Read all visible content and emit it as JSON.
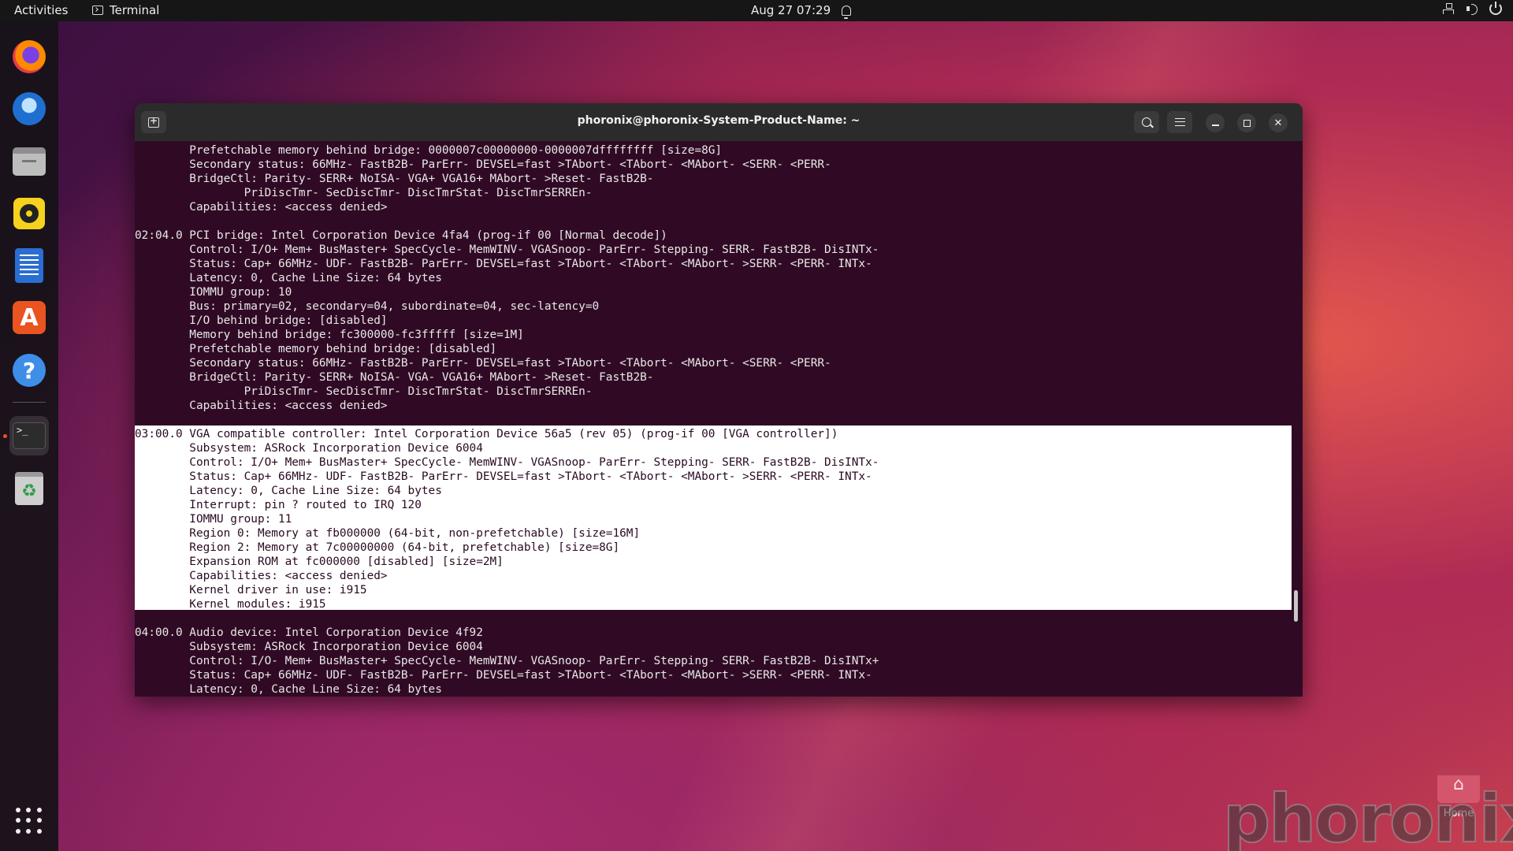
{
  "topbar": {
    "activities": "Activities",
    "app_name": "Terminal",
    "datetime": "Aug 27  07:29",
    "tray_icons": [
      "network-icon",
      "volume-icon",
      "power-icon"
    ]
  },
  "dock": {
    "items": [
      {
        "name": "firefox",
        "icon": "firefox-icon"
      },
      {
        "name": "thunderbird",
        "icon": "thunderbird-icon"
      },
      {
        "name": "files",
        "icon": "files-icon"
      },
      {
        "name": "rhythmbox",
        "icon": "rhythmbox-icon"
      },
      {
        "name": "libreoffice-writer",
        "icon": "writer-icon"
      },
      {
        "name": "app-center",
        "icon": "app-store-icon",
        "glyph": "A"
      },
      {
        "name": "help",
        "icon": "help-icon",
        "glyph": "?"
      },
      {
        "name": "terminal",
        "icon": "terminal-icon",
        "glyph": ">_",
        "active": true
      },
      {
        "name": "trash",
        "icon": "trash-icon",
        "glyph": "♻"
      }
    ],
    "show_apps_icon": "app-grid-icon"
  },
  "terminal": {
    "title": "phoronix@phoronix-System-Product-Name: ~",
    "lines": [
      "        Prefetchable memory behind bridge: 0000007c00000000-0000007dffffffff [size=8G]",
      "        Secondary status: 66MHz- FastB2B- ParErr- DEVSEL=fast >TAbort- <TAbort- <MAbort- <SERR- <PERR-",
      "        BridgeCtl: Parity- SERR+ NoISA- VGA+ VGA16+ MAbort- >Reset- FastB2B-",
      "                PriDiscTmr- SecDiscTmr- DiscTmrStat- DiscTmrSERREn-",
      "        Capabilities: <access denied>",
      "",
      "02:04.0 PCI bridge: Intel Corporation Device 4fa4 (prog-if 00 [Normal decode])",
      "        Control: I/O+ Mem+ BusMaster+ SpecCycle- MemWINV- VGASnoop- ParErr- Stepping- SERR- FastB2B- DisINTx-",
      "        Status: Cap+ 66MHz- UDF- FastB2B- ParErr- DEVSEL=fast >TAbort- <TAbort- <MAbort- >SERR- <PERR- INTx-",
      "        Latency: 0, Cache Line Size: 64 bytes",
      "        IOMMU group: 10",
      "        Bus: primary=02, secondary=04, subordinate=04, sec-latency=0",
      "        I/O behind bridge: [disabled]",
      "        Memory behind bridge: fc300000-fc3fffff [size=1M]",
      "        Prefetchable memory behind bridge: [disabled]",
      "        Secondary status: 66MHz- FastB2B- ParErr- DEVSEL=fast >TAbort- <TAbort- <MAbort- <SERR- <PERR-",
      "        BridgeCtl: Parity- SERR+ NoISA- VGA- VGA16+ MAbort- >Reset- FastB2B-",
      "                PriDiscTmr- SecDiscTmr- DiscTmrStat- DiscTmrSERREn-",
      "        Capabilities: <access denied>",
      "",
      "03:00.0 VGA compatible controller: Intel Corporation Device 56a5 (rev 05) (prog-if 00 [VGA controller])",
      "        Subsystem: ASRock Incorporation Device 6004",
      "        Control: I/O+ Mem+ BusMaster+ SpecCycle- MemWINV- VGASnoop- ParErr- Stepping- SERR- FastB2B- DisINTx-",
      "        Status: Cap+ 66MHz- UDF- FastB2B- ParErr- DEVSEL=fast >TAbort- <TAbort- <MAbort- >SERR- <PERR- INTx-",
      "        Latency: 0, Cache Line Size: 64 bytes",
      "        Interrupt: pin ? routed to IRQ 120",
      "        IOMMU group: 11",
      "        Region 0: Memory at fb000000 (64-bit, non-prefetchable) [size=16M]",
      "        Region 2: Memory at 7c00000000 (64-bit, prefetchable) [size=8G]",
      "        Expansion ROM at fc000000 [disabled] [size=2M]",
      "        Capabilities: <access denied>",
      "        Kernel driver in use: i915",
      "        Kernel modules: i915",
      "",
      "04:00.0 Audio device: Intel Corporation Device 4f92",
      "        Subsystem: ASRock Incorporation Device 6004",
      "        Control: I/O- Mem+ BusMaster+ SpecCycle- MemWINV- VGASnoop- ParErr- Stepping- SERR- FastB2B- DisINTx+",
      "        Status: Cap+ 66MHz- UDF- FastB2B- ParErr- DEVSEL=fast >TAbort- <TAbort- <MAbort- >SERR- <PERR- INTx-",
      "        Latency: 0, Cache Line Size: 64 bytes"
    ],
    "highlight_start": 20,
    "highlight_end": 32
  },
  "desktop": {
    "home_label": "Home",
    "watermark": "phoronix"
  }
}
